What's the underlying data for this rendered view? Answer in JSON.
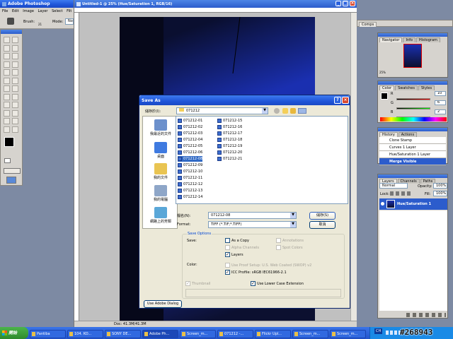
{
  "app": {
    "title": "Adobe Photoshop",
    "menu": [
      "File",
      "Edit",
      "Image",
      "Layer",
      "Select",
      "Filt"
    ],
    "options": {
      "brush_label": "Brush:",
      "brush_size": "21",
      "mode_label": "Mode:",
      "mode_value": "No"
    }
  },
  "document": {
    "title": "Untitled-1 @ 25% (Hue/Saturation 1, RGB/16)",
    "status": "Doc: 41.3M/41.3M",
    "zoom": "25%"
  },
  "brushes_tab": "Comps",
  "navigator": {
    "tabs": [
      "Navigator",
      "Info",
      "Histogram"
    ],
    "zoom": "25%"
  },
  "color_panel": {
    "tabs": [
      "Color",
      "Swatches",
      "Styles"
    ],
    "r": "10",
    "g": "6",
    "b": "2",
    "r_label": "R",
    "g_label": "G",
    "b_label": "B"
  },
  "history_panel": {
    "tabs": [
      "History",
      "Actions"
    ],
    "items": [
      "Clone Stamp",
      "Curves 1 Layer",
      "Hue/Saturation 1 Layer",
      "Merge Visible"
    ],
    "selected_index": 3
  },
  "layers_panel": {
    "tabs": [
      "Layers",
      "Channels",
      "Paths"
    ],
    "blend_mode": "Normal",
    "opacity_label": "Opacity:",
    "opacity": "100%",
    "lock_label": "Lock:",
    "fill_label": "Fill:",
    "fill": "100%",
    "layer_name": "Hue/Saturation 1"
  },
  "dialog": {
    "title": "Save As",
    "save_in_label": "儲存於(I):",
    "save_in_value": "071212",
    "places": [
      "我最近的文件",
      "桌面",
      "我的文件",
      "我的電腦",
      "網路上的芳鄰"
    ],
    "files": [
      "071212-01",
      "071212-02",
      "071212-03",
      "071212-04",
      "071212-05",
      "071212-06",
      "071212-08",
      "071212-09",
      "071212-10",
      "071212-11",
      "071212-12",
      "071212-13",
      "071212-14",
      "071212-15",
      "071212-16",
      "071212-17",
      "071212-18",
      "071212-19",
      "071212-20",
      "071212-21"
    ],
    "selected_file_index": 6,
    "filename_label": "檔名(N):",
    "filename_value": "071212-08",
    "format_label": "Format:",
    "format_value": "TIFF (*.TIF;*.TIFF)",
    "save_button": "儲存(S)",
    "cancel_button": "取消",
    "save_options_title": "Save Options",
    "save_label": "Save:",
    "opts": {
      "as_copy": "As a Copy",
      "annotations": "Annotations",
      "alpha": "Alpha Channels",
      "spot": "Spot Colors",
      "layers": "Layers"
    },
    "color_label": "Color:",
    "proof_setup": "Use Proof Setup:  U.S. Web Coated (SWOP) v2",
    "icc_profile": "ICC Profile:  sRGB IEC61966-2.1",
    "thumbnail": "Thumbnail",
    "lowercase": "Use Lower Case Extension",
    "adobe_dialog_button": "Use Adobe Dialog"
  },
  "taskbar": {
    "start": "開始",
    "items": [
      "Pantiba",
      "104. KO...",
      "SONY DE...",
      "Adobe Ph...",
      "Screen_m...",
      "071212 -...",
      "Flickr Upl...",
      "Screen_m...",
      "Screen_m..."
    ],
    "lang": "CH",
    "watermark": "#268943"
  }
}
